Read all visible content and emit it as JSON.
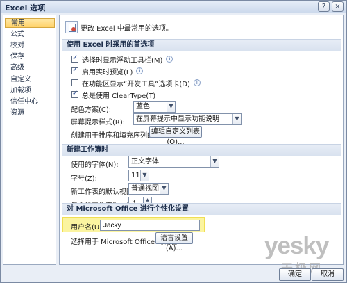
{
  "window": {
    "title": "Excel 选项",
    "help_button": "?",
    "close_button": "×"
  },
  "sidebar": {
    "items": [
      {
        "label": "常用"
      },
      {
        "label": "公式"
      },
      {
        "label": "校对"
      },
      {
        "label": "保存"
      },
      {
        "label": "高级"
      },
      {
        "label": "自定义"
      },
      {
        "label": "加载项"
      },
      {
        "label": "信任中心"
      },
      {
        "label": "资源"
      }
    ]
  },
  "intro": {
    "text": "更改 Excel 中最常用的选项。"
  },
  "sections": {
    "preferred": {
      "header": "使用 Excel 时采用的首选项",
      "options": [
        {
          "label": "选择时显示浮动工具栏(M)",
          "checked": true
        },
        {
          "label": "启用实时预览(L)",
          "checked": true
        },
        {
          "label": "在功能区显示“开发工具”选项卡(D)",
          "checked": false
        },
        {
          "label": "总是使用 ClearType(T)",
          "checked": true
        }
      ],
      "color_scheme_label": "配色方案(C):",
      "color_scheme_value": "蓝色",
      "tooltip_style_label": "屏幕提示样式(R):",
      "tooltip_style_value": "在屏幕提示中显示功能说明",
      "custom_list_label": "创建用于排序和填充序列的列表:",
      "custom_list_button": "编辑自定义列表(O)..."
    },
    "new_workbook": {
      "header": "新建工作簿时",
      "font_label": "使用的字体(N):",
      "font_value": "正文字体",
      "size_label": "字号(Z):",
      "size_value": "11",
      "view_label": "新工作表的默认视图(V):",
      "view_value": "普通视图",
      "sheets_label": "包含的工作表数(S):",
      "sheets_value": "3"
    },
    "personalize": {
      "header": "对 Microsoft Office 进行个性化设置",
      "username_label": "用户名(U):",
      "username_value": "Jacky",
      "language_label": "选择用于 Microsoft Office 的语言:",
      "language_button": "语言设置(A)..."
    }
  },
  "footer": {
    "ok": "确定",
    "cancel": "取消"
  },
  "watermark": {
    "main": "yesky",
    "sub": "天极网"
  },
  "icons": {
    "info": "info-icon",
    "check": "checkmark-icon",
    "dropdown": "chevron-down-icon"
  }
}
